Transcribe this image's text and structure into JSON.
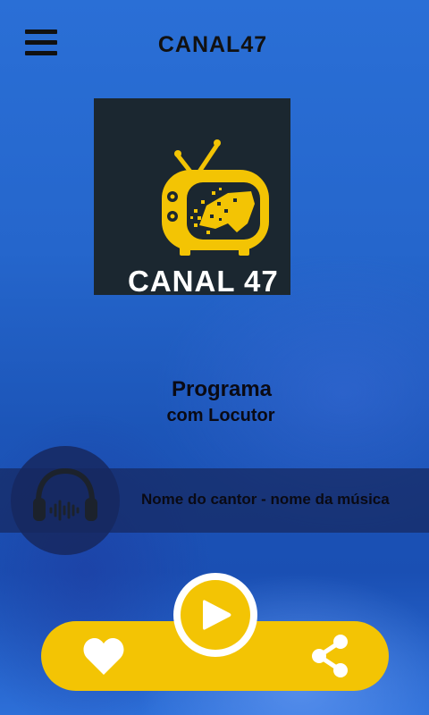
{
  "header": {
    "title": "CANAL47",
    "menu_icon": "hamburger-menu-icon"
  },
  "logo": {
    "text": "CANAL 47",
    "icon": "retro-tv-icon",
    "colors": {
      "background": "#1b2730",
      "tv": "#f3c404",
      "text": "#ffffff"
    }
  },
  "program": {
    "title": "Programa",
    "host": "com Locutor"
  },
  "now_playing": {
    "text": "Nome do cantor - nome da música",
    "icon": "headphones-icon"
  },
  "controls": {
    "like_icon": "heart-icon",
    "play_icon": "play-icon",
    "share_icon": "share-icon",
    "accent_color": "#f3c404"
  }
}
